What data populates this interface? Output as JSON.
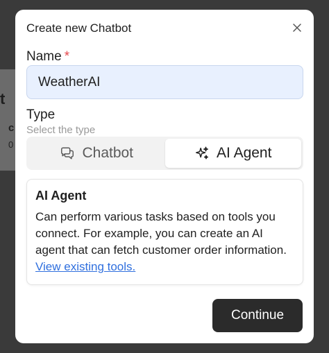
{
  "background": {
    "heading_fragment": "t",
    "card_fragment": "c",
    "card_sub_fragment": "0"
  },
  "modal": {
    "title": "Create new Chatbot",
    "close_icon": "close-icon"
  },
  "name_field": {
    "label": "Name",
    "required_mark": "*",
    "value": "WeatherAI"
  },
  "type_field": {
    "label": "Type",
    "hint": "Select the type",
    "options": [
      {
        "label": "Chatbot",
        "icon": "chat-bubbles-icon",
        "selected": false
      },
      {
        "label": "AI Agent",
        "icon": "sparkles-icon",
        "selected": true
      }
    ]
  },
  "info": {
    "title": "AI Agent",
    "body": "Can perform various tasks based on tools you connect. For example, you can create an AI agent that can fetch customer order information.",
    "link_text": "View existing tools."
  },
  "footer": {
    "continue_label": "Continue"
  },
  "colors": {
    "accent_link": "#2f6fde",
    "required": "#e5484d",
    "primary_button": "#2b2b2b",
    "input_bg": "#e8f0fe"
  }
}
